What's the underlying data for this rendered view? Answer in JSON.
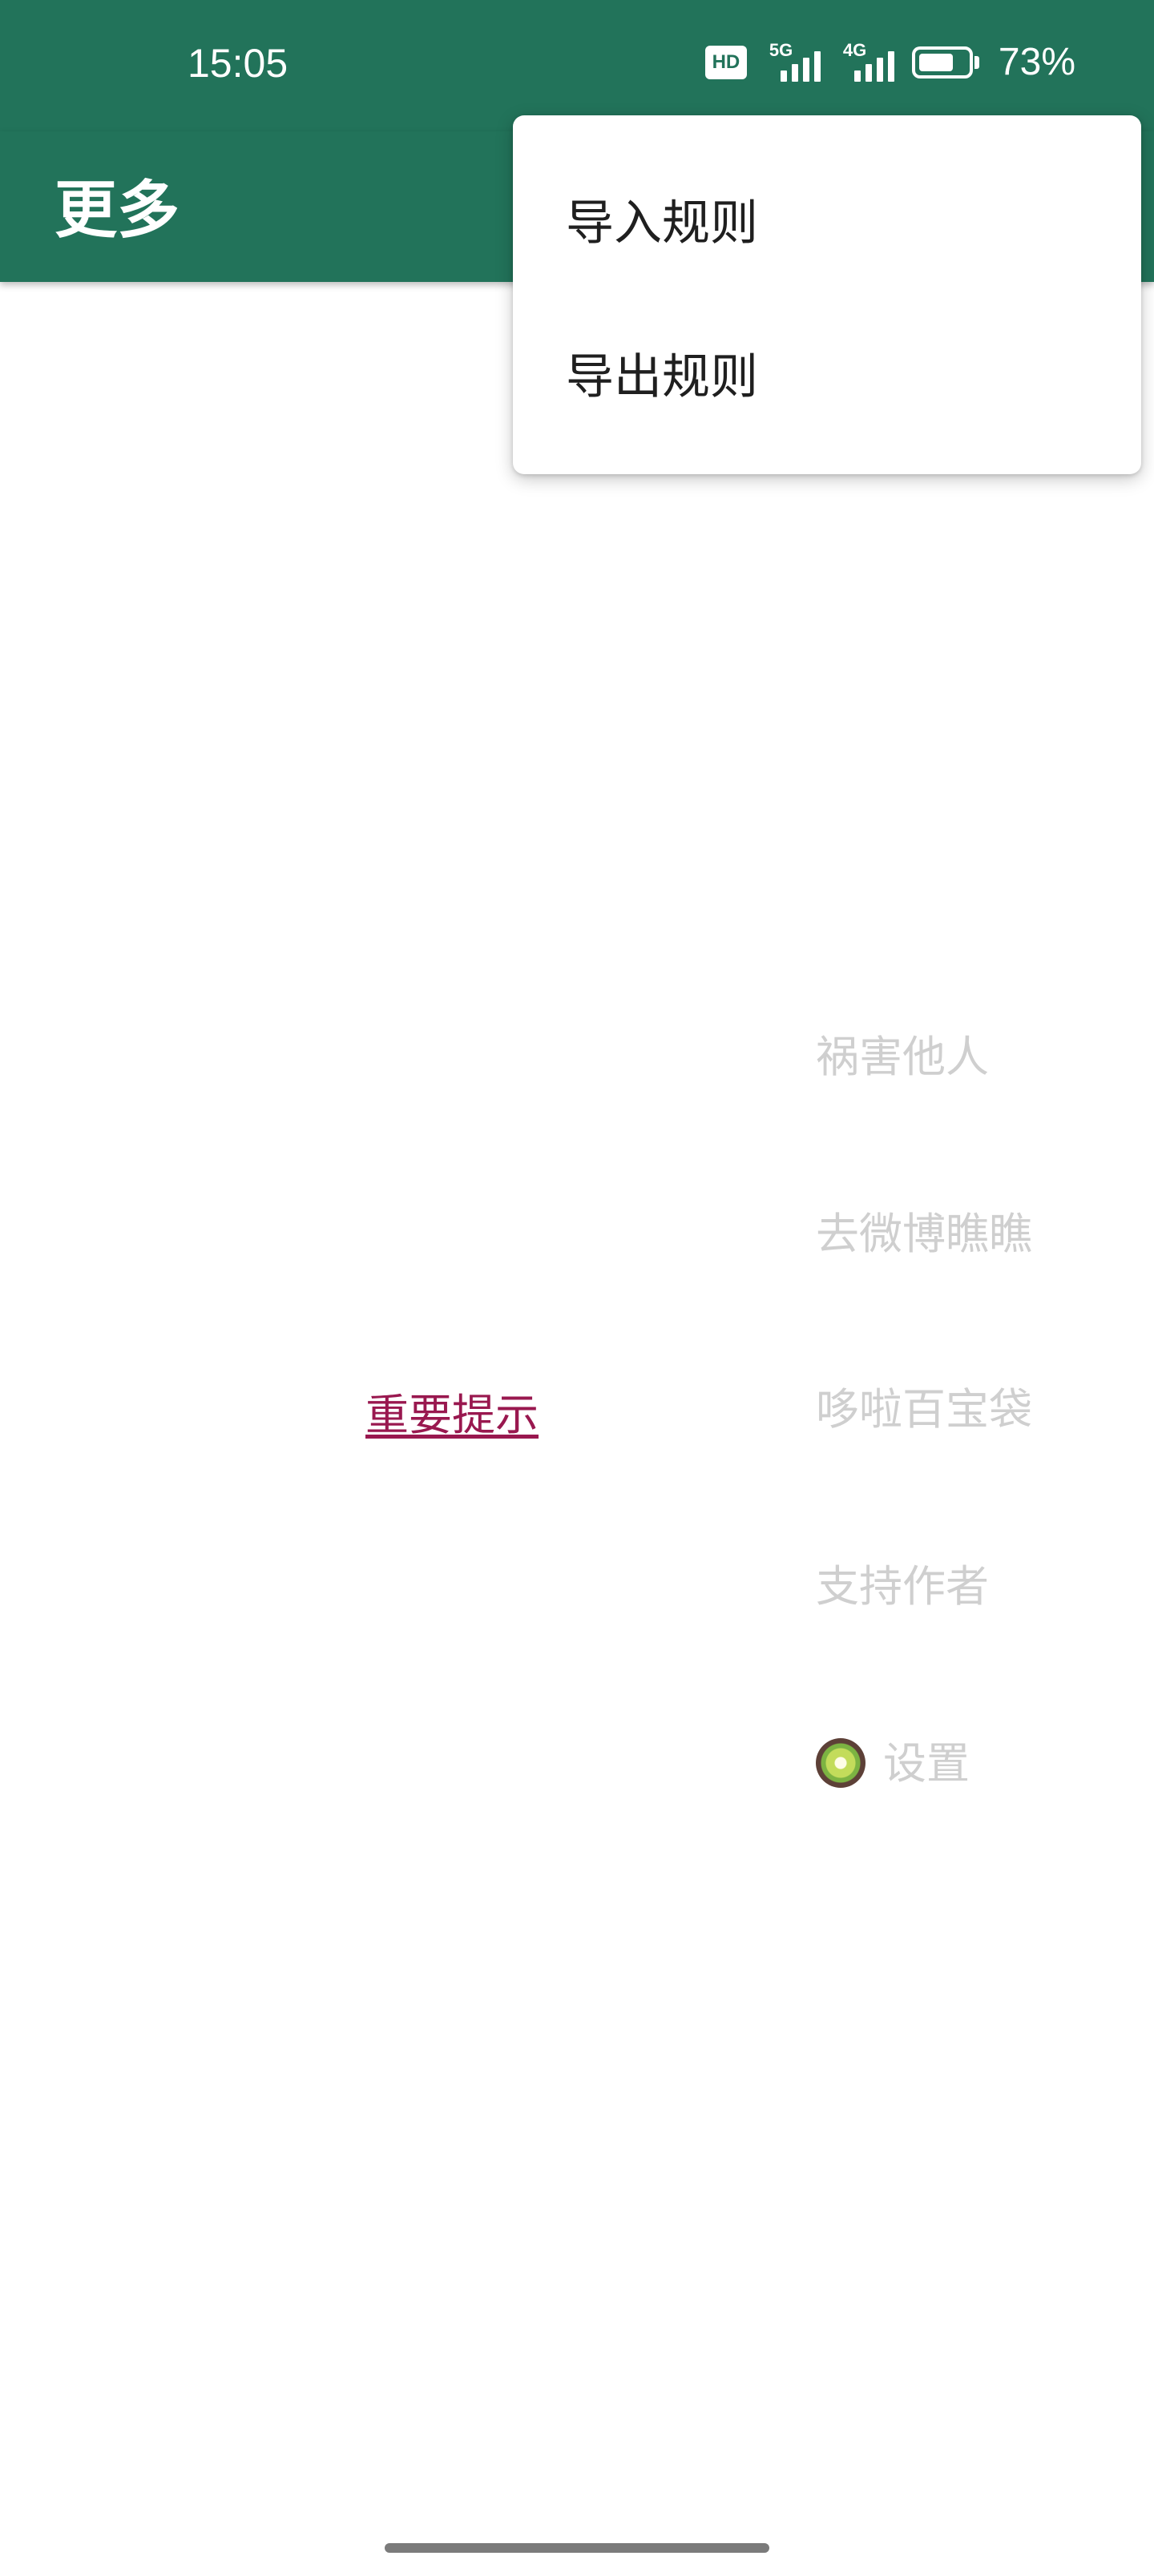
{
  "status_bar": {
    "time": "15:05",
    "hd_label": "HD",
    "sim1_network": "5G",
    "sim2_network": "4G",
    "battery_percent": "73%",
    "battery_level": 0.73
  },
  "app_bar": {
    "title": "更多",
    "background_color": "#22735A"
  },
  "menu": {
    "items": [
      {
        "label": "导入规则"
      },
      {
        "label": "导出规则"
      }
    ]
  },
  "main": {
    "side_items": [
      {
        "label": "祸害他人"
      },
      {
        "label": "去微博瞧瞧"
      },
      {
        "label": "哆啦百宝袋"
      },
      {
        "label": "支持作者"
      },
      {
        "label": "设置",
        "icon": "kiwi-icon"
      }
    ],
    "important_link": "重要提示",
    "important_link_color": "#99184F"
  }
}
